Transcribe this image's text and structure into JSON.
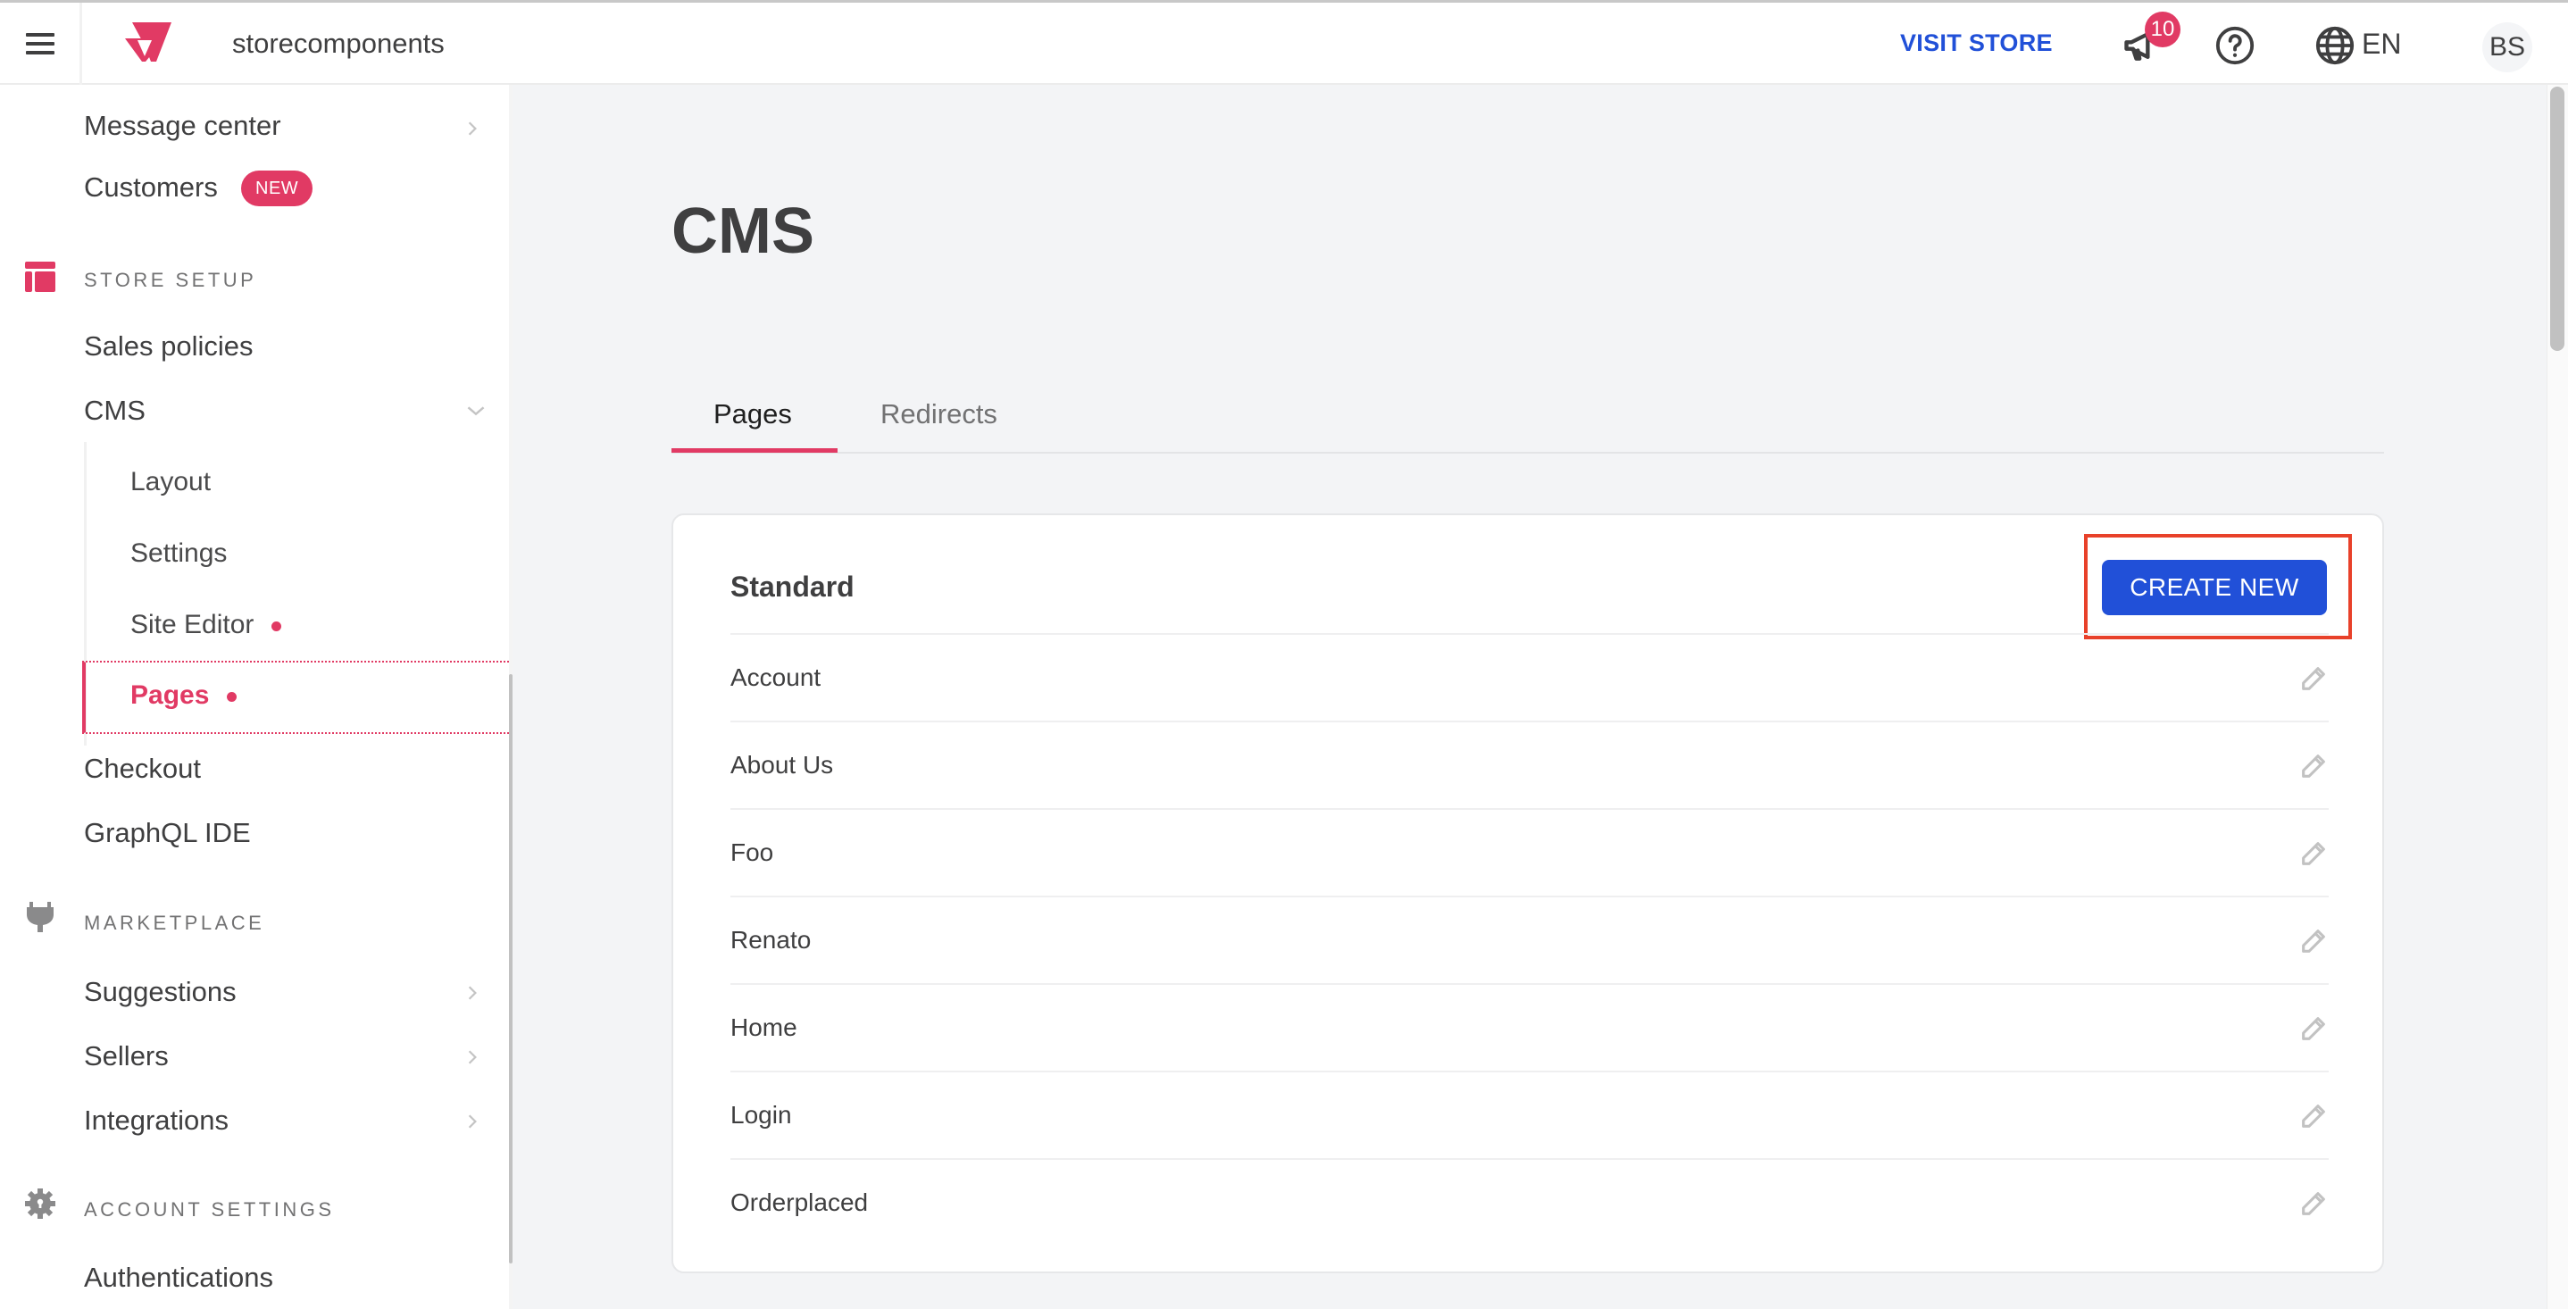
{
  "topbar": {
    "account_name": "storecomponents",
    "visit_store_label": "VISIT STORE",
    "notifications_count": "10",
    "language": "EN",
    "avatar_initials": "BS",
    "icons": {
      "menu": "hamburger-menu-icon",
      "logo": "vtex-logo",
      "notifications": "megaphone-icon",
      "help": "help-circle-icon",
      "language": "globe-icon"
    }
  },
  "sidebar": {
    "items_top": [
      {
        "label": "Message center",
        "chevron": "chevron-right"
      },
      {
        "label": "Customers",
        "badge": "NEW"
      }
    ],
    "sections": [
      {
        "title": "STORE SETUP",
        "icon": "layout-icon",
        "items": [
          {
            "label": "Sales policies"
          },
          {
            "label": "CMS",
            "chevron": "chevron-down",
            "expanded": true,
            "children": [
              {
                "label": "Layout"
              },
              {
                "label": "Settings"
              },
              {
                "label": "Site Editor",
                "dot": true
              },
              {
                "label": "Pages",
                "dot": true,
                "active": true
              }
            ]
          },
          {
            "label": "Checkout"
          },
          {
            "label": "GraphQL IDE"
          }
        ]
      },
      {
        "title": "MARKETPLACE",
        "icon": "plug-icon",
        "items": [
          {
            "label": "Suggestions",
            "chevron": "chevron-right"
          },
          {
            "label": "Sellers",
            "chevron": "chevron-right"
          },
          {
            "label": "Integrations",
            "chevron": "chevron-right"
          }
        ]
      },
      {
        "title": "ACCOUNT SETTINGS",
        "icon": "gear-lock-icon",
        "items": [
          {
            "label": "Authentications"
          }
        ]
      }
    ]
  },
  "main": {
    "title": "CMS",
    "tabs": [
      {
        "label": "Pages",
        "active": true
      },
      {
        "label": "Redirects",
        "active": false
      }
    ],
    "card": {
      "title": "Standard",
      "create_button_label": "CREATE NEW",
      "rows": [
        {
          "label": "Account"
        },
        {
          "label": "About Us"
        },
        {
          "label": "Foo"
        },
        {
          "label": "Renato"
        },
        {
          "label": "Home"
        },
        {
          "label": "Login"
        },
        {
          "label": "Orderplaced"
        }
      ]
    }
  },
  "colors": {
    "brand_pink": "#e13a64",
    "primary_blue": "#2150d8",
    "highlight_red": "#e8412a",
    "page_bg": "#f3f4f6"
  }
}
